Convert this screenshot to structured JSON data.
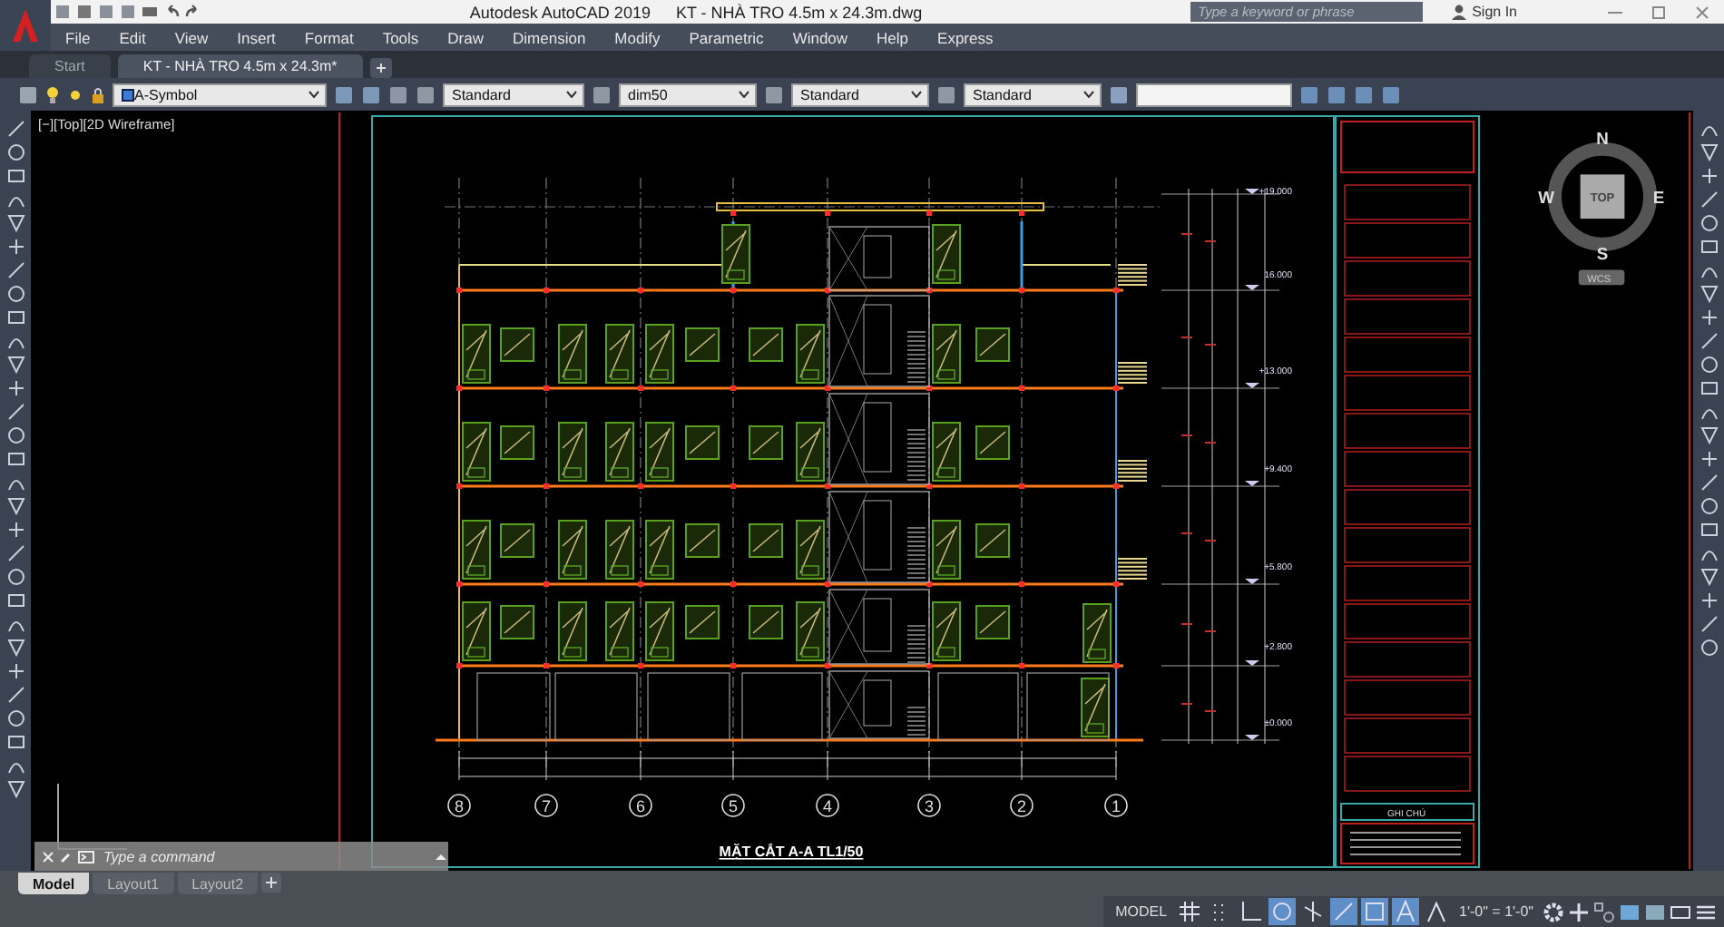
{
  "title_bar": {
    "app_name": "Autodesk AutoCAD 2019",
    "file_name": "KT - NHÀ TRO 4.5m x 24.3m.dwg",
    "search": {
      "placeholder": "Type a keyword or phrase"
    },
    "sign_in": "Sign In"
  },
  "menu": [
    "File",
    "Edit",
    "View",
    "Insert",
    "Format",
    "Tools",
    "Draw",
    "Dimension",
    "Modify",
    "Parametric",
    "Window",
    "Help",
    "Express"
  ],
  "document_tabs": [
    {
      "label": "Start",
      "selected": false
    },
    {
      "label": "KT - NHÀ TRO 4.5m x 24.3m*",
      "selected": true
    }
  ],
  "properties_toolbar": {
    "layer": "A-Symbol",
    "text_style": "Standard",
    "dim_style": "dim50",
    "table_style": "Standard",
    "multileader_style": "Standard"
  },
  "viewport_label": "[−][Top][2D Wireframe]",
  "viewcube": {
    "north": "N",
    "south": "S",
    "east": "E",
    "west": "W",
    "face": "TOP",
    "ucs": "WCS"
  },
  "drawing": {
    "title": "MẶT CẮT A-A TL1/50",
    "notes_title": "GHI CHÚ",
    "levels": [
      "+19.000",
      "16.000",
      "+13.000",
      "+9.400",
      "+5.800",
      "+2.800",
      "±0.000"
    ],
    "axes": [
      "8",
      "7",
      "6",
      "5",
      "4",
      "3",
      "2",
      "1"
    ]
  },
  "command_line": {
    "placeholder": "Type a command"
  },
  "layout_tabs": [
    {
      "label": "Model",
      "selected": true
    },
    {
      "label": "Layout1",
      "selected": false
    },
    {
      "label": "Layout2",
      "selected": false
    }
  ],
  "status_bar": {
    "model": "MODEL",
    "scale": "1'-0\" = 1'-0\"",
    "toggles": [
      {
        "kind": "grid",
        "on": false
      },
      {
        "kind": "snap",
        "on": false
      },
      {
        "kind": "ortho",
        "on": false
      },
      {
        "kind": "polar",
        "on": true
      },
      {
        "kind": "isometric",
        "on": false
      },
      {
        "kind": "tracking",
        "on": true
      },
      {
        "kind": "osnap",
        "on": true
      },
      {
        "kind": "annotation",
        "on": true
      },
      {
        "kind": "autoscale",
        "on": false
      }
    ]
  }
}
